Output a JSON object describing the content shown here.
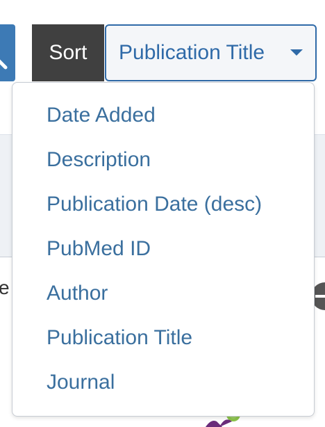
{
  "sort": {
    "label": "Sort",
    "selected": "Publication Title",
    "options": [
      "Date Added",
      "Description",
      "Publication Date (desc)",
      "PubMed ID",
      "Author",
      "Publication Title",
      "Journal"
    ]
  },
  "background": {
    "text_fragment": "e"
  },
  "colors": {
    "accent": "#2f6aa8",
    "menu_text": "#3a6f9e",
    "sort_label_bg": "#404040",
    "search_button_bg": "#3d7ab5"
  }
}
